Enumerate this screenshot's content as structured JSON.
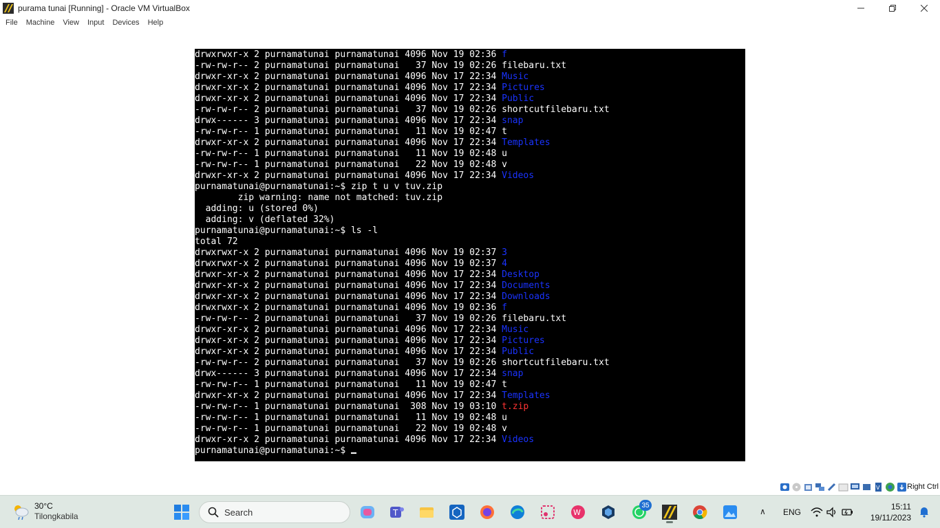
{
  "window": {
    "title": "purama tunai [Running] - Oracle VM VirtualBox",
    "minimize_icon": "minimize-icon",
    "maximize_icon": "restore-icon",
    "close_icon": "close-icon"
  },
  "menu": [
    "File",
    "Machine",
    "View",
    "Input",
    "Devices",
    "Help"
  ],
  "terminal": {
    "lines": [
      {
        "pre": "drwxrwxr-x 2 purnamatunai purnamatunai 4096 Nov 19 02:36 ",
        "name": "f",
        "kind": "dir"
      },
      {
        "pre": "-rw-rw-r-- 2 purnamatunai purnamatunai   37 Nov 19 02:26 ",
        "name": "filebaru.txt",
        "kind": "file"
      },
      {
        "pre": "drwxr-xr-x 2 purnamatunai purnamatunai 4096 Nov 17 22:34 ",
        "name": "Music",
        "kind": "dir"
      },
      {
        "pre": "drwxr-xr-x 2 purnamatunai purnamatunai 4096 Nov 17 22:34 ",
        "name": "Pictures",
        "kind": "dir"
      },
      {
        "pre": "drwxr-xr-x 2 purnamatunai purnamatunai 4096 Nov 17 22:34 ",
        "name": "Public",
        "kind": "dir"
      },
      {
        "pre": "-rw-rw-r-- 2 purnamatunai purnamatunai   37 Nov 19 02:26 ",
        "name": "shortcutfilebaru.txt",
        "kind": "file"
      },
      {
        "pre": "drwx------ 3 purnamatunai purnamatunai 4096 Nov 17 22:34 ",
        "name": "snap",
        "kind": "dir"
      },
      {
        "pre": "-rw-rw-r-- 1 purnamatunai purnamatunai   11 Nov 19 02:47 ",
        "name": "t",
        "kind": "file"
      },
      {
        "pre": "drwxr-xr-x 2 purnamatunai purnamatunai 4096 Nov 17 22:34 ",
        "name": "Templates",
        "kind": "dir"
      },
      {
        "pre": "-rw-rw-r-- 1 purnamatunai purnamatunai   11 Nov 19 02:48 ",
        "name": "u",
        "kind": "file"
      },
      {
        "pre": "-rw-rw-r-- 1 purnamatunai purnamatunai   22 Nov 19 02:48 ",
        "name": "v",
        "kind": "file"
      },
      {
        "pre": "drwxr-xr-x 2 purnamatunai purnamatunai 4096 Nov 17 22:34 ",
        "name": "Videos",
        "kind": "dir"
      },
      {
        "pre": "purnamatunai@purnamatunai:~$ zip t u v tuv.zip",
        "name": "",
        "kind": "text"
      },
      {
        "pre": "        zip warning: name not matched: tuv.zip",
        "name": "",
        "kind": "text"
      },
      {
        "pre": "  adding: u (stored 0%)",
        "name": "",
        "kind": "text"
      },
      {
        "pre": "  adding: v (deflated 32%)",
        "name": "",
        "kind": "text"
      },
      {
        "pre": "purnamatunai@purnamatunai:~$ ls -l",
        "name": "",
        "kind": "text"
      },
      {
        "pre": "total 72",
        "name": "",
        "kind": "text"
      },
      {
        "pre": "drwxrwxr-x 2 purnamatunai purnamatunai 4096 Nov 19 02:37 ",
        "name": "3",
        "kind": "dir"
      },
      {
        "pre": "drwxrwxr-x 2 purnamatunai purnamatunai 4096 Nov 19 02:37 ",
        "name": "4",
        "kind": "dir"
      },
      {
        "pre": "drwxr-xr-x 2 purnamatunai purnamatunai 4096 Nov 17 22:34 ",
        "name": "Desktop",
        "kind": "dir"
      },
      {
        "pre": "drwxr-xr-x 2 purnamatunai purnamatunai 4096 Nov 17 22:34 ",
        "name": "Documents",
        "kind": "dir"
      },
      {
        "pre": "drwxr-xr-x 2 purnamatunai purnamatunai 4096 Nov 17 22:34 ",
        "name": "Downloads",
        "kind": "dir"
      },
      {
        "pre": "drwxrwxr-x 2 purnamatunai purnamatunai 4096 Nov 19 02:36 ",
        "name": "f",
        "kind": "dir"
      },
      {
        "pre": "-rw-rw-r-- 2 purnamatunai purnamatunai   37 Nov 19 02:26 ",
        "name": "filebaru.txt",
        "kind": "file"
      },
      {
        "pre": "drwxr-xr-x 2 purnamatunai purnamatunai 4096 Nov 17 22:34 ",
        "name": "Music",
        "kind": "dir"
      },
      {
        "pre": "drwxr-xr-x 2 purnamatunai purnamatunai 4096 Nov 17 22:34 ",
        "name": "Pictures",
        "kind": "dir"
      },
      {
        "pre": "drwxr-xr-x 2 purnamatunai purnamatunai 4096 Nov 17 22:34 ",
        "name": "Public",
        "kind": "dir"
      },
      {
        "pre": "-rw-rw-r-- 2 purnamatunai purnamatunai   37 Nov 19 02:26 ",
        "name": "shortcutfilebaru.txt",
        "kind": "file"
      },
      {
        "pre": "drwx------ 3 purnamatunai purnamatunai 4096 Nov 17 22:34 ",
        "name": "snap",
        "kind": "dir"
      },
      {
        "pre": "-rw-rw-r-- 1 purnamatunai purnamatunai   11 Nov 19 02:47 ",
        "name": "t",
        "kind": "file"
      },
      {
        "pre": "drwxr-xr-x 2 purnamatunai purnamatunai 4096 Nov 17 22:34 ",
        "name": "Templates",
        "kind": "dir"
      },
      {
        "pre": "-rw-rw-r-- 1 purnamatunai purnamatunai  308 Nov 19 03:10 ",
        "name": "t.zip",
        "kind": "zip"
      },
      {
        "pre": "-rw-rw-r-- 1 purnamatunai purnamatunai   11 Nov 19 02:48 ",
        "name": "u",
        "kind": "file"
      },
      {
        "pre": "-rw-rw-r-- 1 purnamatunai purnamatunai   22 Nov 19 02:48 ",
        "name": "v",
        "kind": "file"
      },
      {
        "pre": "drwxr-xr-x 2 purnamatunai purnamatunai 4096 Nov 17 22:34 ",
        "name": "Videos",
        "kind": "dir"
      }
    ],
    "prompt": "purnamatunai@purnamatunai:~$ ",
    "colors": {
      "background": "#000000",
      "text": "#ffffff",
      "directory": "#1a33ff",
      "archive": "#ff3333"
    }
  },
  "statusbar": {
    "host_key": "Right Ctrl",
    "icons": [
      "hard-disk-icon",
      "optical-drive-icon",
      "audio-icon",
      "network-icon",
      "usb-icon",
      "shared-folder-icon",
      "display-icon",
      "recording-icon",
      "cpu-icon",
      "mouse-integration-icon",
      "keyboard-icon"
    ]
  },
  "taskbar": {
    "weather": {
      "temp": "30°C",
      "location": "Tilongkabila",
      "icon": "partly-cloudy-rain-icon"
    },
    "search_label": "Search",
    "apps": [
      {
        "name": "copilot-icon"
      },
      {
        "name": "teams-icon"
      },
      {
        "name": "file-explorer-icon"
      },
      {
        "name": "dev-app-icon"
      },
      {
        "name": "firefox-icon"
      },
      {
        "name": "edge-icon"
      },
      {
        "name": "snipping-tool-icon"
      },
      {
        "name": "wps-office-icon"
      },
      {
        "name": "virtualbox-icon"
      },
      {
        "name": "whatsapp-icon",
        "badge": "35"
      },
      {
        "name": "virtualbox-vm-icon"
      },
      {
        "name": "chrome-icon"
      },
      {
        "name": "photos-icon"
      }
    ],
    "tray": {
      "language": "ENG",
      "time": "15:11",
      "date": "19/11/2023"
    }
  }
}
